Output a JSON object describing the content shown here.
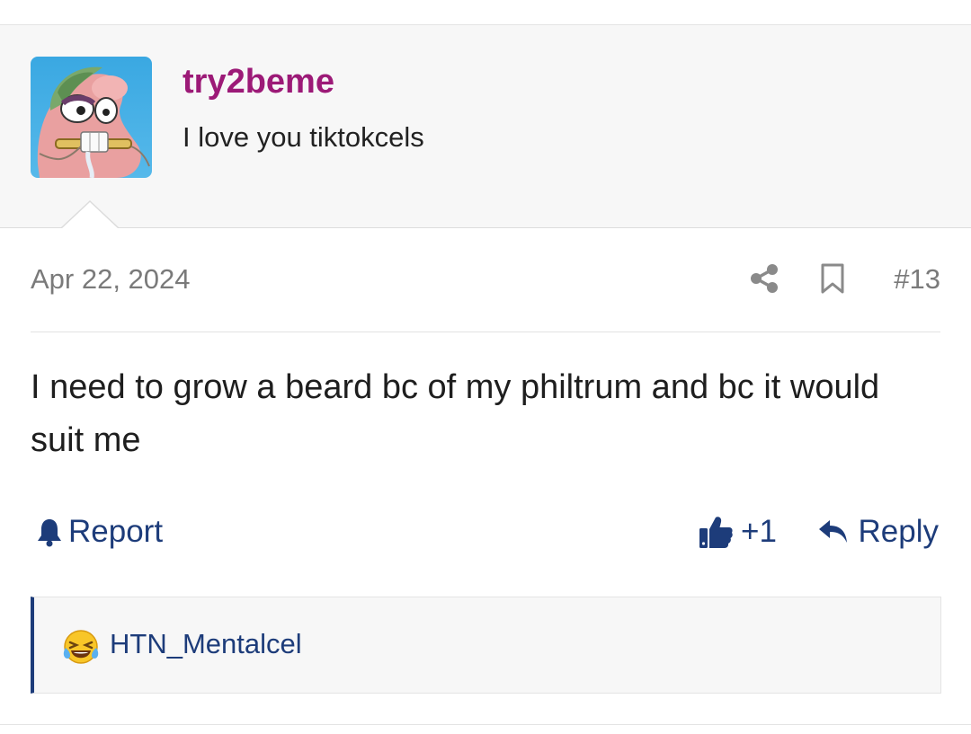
{
  "post": {
    "author": {
      "username": "try2beme",
      "user_title": "I love you tiktokcels",
      "avatar_icon": "patrick-star-avatar"
    },
    "date": "Apr 22, 2024",
    "post_number": "#13",
    "body": "I need to grow a beard bc of my philtrum and bc it would suit me",
    "actions": {
      "report_label": "Report",
      "like_count": "+1",
      "reply_label": "Reply"
    },
    "reactions": {
      "emoji_icon": "crying-laughing-emoji",
      "users": "HTN_Mentalcel"
    }
  },
  "colors": {
    "username": "#9c1a77",
    "link": "#1d3c7a",
    "meta": "#7a7a7a",
    "panel": "#f7f7f7"
  }
}
